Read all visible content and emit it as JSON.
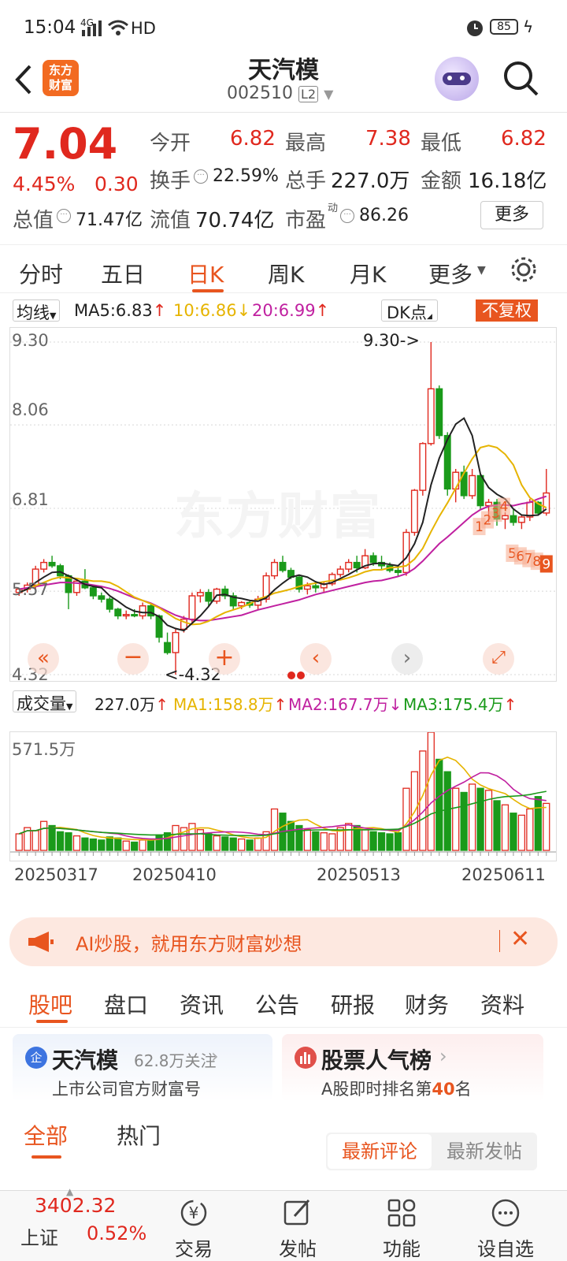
{
  "status_bar": {
    "time": "15:04",
    "net": "HD",
    "battery": "85"
  },
  "header": {
    "logo_text": "东方\n财富",
    "title": "天汽模",
    "code": "002510",
    "level": "L2"
  },
  "quote": {
    "price": "7.04",
    "change_pct": "4.45%",
    "change": "0.30",
    "open_label": "今开",
    "open": "6.82",
    "high_label": "最高",
    "high": "7.38",
    "low_label": "最低",
    "low": "6.82",
    "turnover_label": "换手",
    "turnover": "22.59%",
    "volume_label": "总手",
    "volume": "227.0万",
    "amount_label": "金额",
    "amount": "16.18亿",
    "mcap_label": "总值",
    "mcap": "71.47亿",
    "float_label": "流值",
    "float_cap": "70.74亿",
    "pe_label": "市盈",
    "pe_sup": "动",
    "pe": "86.26",
    "more": "更多"
  },
  "chart_tabs": [
    "分时",
    "五日",
    "日K",
    "周K",
    "月K",
    "更多"
  ],
  "ma_bar": {
    "selector": "均线",
    "ma5": "MA5:6.83",
    "ma10": "10:6.86",
    "ma20": "20:6.99",
    "dk": "DK点",
    "adjust": "不复权"
  },
  "price_axis": [
    "9.30",
    "8.06",
    "6.81",
    "5.57",
    "4.32"
  ],
  "annotations": {
    "high": "9.30->",
    "low": "<-4.32"
  },
  "watermark": "东方财富",
  "signals": [
    "1",
    "2",
    "3",
    "4",
    "5",
    "6",
    "7",
    "8",
    "9"
  ],
  "vol_bar": {
    "selector": "成交量",
    "vol": "227.0万",
    "ma1": "MA1:158.8万",
    "ma2": "MA2:167.7万",
    "ma3": "MA3:175.4万"
  },
  "vol_axis": "571.5万",
  "dates": [
    "20250317",
    "20250410",
    "20250513",
    "20250611"
  ],
  "banner": {
    "text": "AI炒股，就用东方财富妙想"
  },
  "info_tabs": [
    "股吧",
    "盘口",
    "资讯",
    "公告",
    "研报",
    "财务",
    "资料"
  ],
  "card1": {
    "badge": "企",
    "title": "天汽模",
    "follow": "62.8万关注",
    "sub": "上市公司官方财富号"
  },
  "card2": {
    "title": "股票人气榜",
    "sub_pre": "A股即时排名第",
    "rank": "40",
    "sub_post": "名"
  },
  "filter_tabs": [
    "全部",
    "热门"
  ],
  "sort_tabs": [
    "最新评论",
    "最新发帖"
  ],
  "bottom": {
    "index_value": "3402.32",
    "index_name": "上证",
    "index_pct": "0.52%",
    "items": [
      "交易",
      "发帖",
      "功能",
      "设自选"
    ]
  },
  "chart_data": {
    "type": "candlestick",
    "ylim": [
      4.32,
      9.3
    ],
    "candles": [
      [
        5.55,
        5.62,
        5.5,
        5.6
      ],
      [
        5.6,
        5.7,
        5.55,
        5.66
      ],
      [
        5.66,
        5.95,
        5.6,
        5.9
      ],
      [
        5.9,
        6.05,
        5.85,
        6.0
      ],
      [
        6.0,
        6.1,
        5.92,
        5.95
      ],
      [
        5.95,
        5.98,
        5.75,
        5.8
      ],
      [
        5.8,
        5.82,
        5.3,
        5.55
      ],
      [
        5.55,
        5.75,
        5.5,
        5.72
      ],
      [
        5.72,
        5.9,
        5.6,
        5.62
      ],
      [
        5.62,
        5.65,
        5.45,
        5.5
      ],
      [
        5.5,
        5.55,
        5.4,
        5.45
      ],
      [
        5.45,
        5.48,
        5.25,
        5.3
      ],
      [
        5.3,
        5.32,
        5.15,
        5.2
      ],
      [
        5.2,
        5.28,
        5.15,
        5.22
      ],
      [
        5.22,
        5.3,
        5.18,
        5.2
      ],
      [
        5.2,
        5.4,
        5.15,
        5.35
      ],
      [
        5.35,
        5.38,
        5.15,
        5.2
      ],
      [
        5.2,
        5.22,
        4.8,
        4.88
      ],
      [
        4.8,
        4.95,
        4.62,
        4.65
      ],
      [
        4.65,
        5.02,
        4.32,
        4.95
      ],
      [
        5.0,
        5.2,
        4.95,
        5.15
      ],
      [
        5.15,
        5.55,
        5.1,
        5.5
      ],
      [
        5.5,
        5.6,
        5.4,
        5.55
      ],
      [
        5.55,
        5.6,
        5.35,
        5.42
      ],
      [
        5.42,
        5.62,
        5.38,
        5.6
      ],
      [
        5.6,
        5.65,
        5.45,
        5.5
      ],
      [
        5.5,
        5.55,
        5.3,
        5.35
      ],
      [
        5.35,
        5.42,
        5.3,
        5.4
      ],
      [
        5.4,
        5.42,
        5.32,
        5.36
      ],
      [
        5.36,
        5.5,
        5.3,
        5.45
      ],
      [
        5.45,
        5.85,
        5.4,
        5.8
      ],
      [
        5.8,
        6.05,
        5.75,
        6.0
      ],
      [
        6.0,
        6.1,
        5.85,
        5.88
      ],
      [
        5.88,
        5.92,
        5.75,
        5.78
      ],
      [
        5.78,
        5.8,
        5.55,
        5.6
      ],
      [
        5.6,
        5.7,
        5.52,
        5.65
      ],
      [
        5.65,
        5.72,
        5.55,
        5.62
      ],
      [
        5.62,
        5.7,
        5.55,
        5.68
      ],
      [
        5.68,
        5.85,
        5.65,
        5.82
      ],
      [
        5.82,
        5.95,
        5.78,
        5.9
      ],
      [
        5.9,
        6.05,
        5.85,
        6.0
      ],
      [
        6.0,
        6.1,
        5.85,
        5.92
      ],
      [
        5.92,
        6.2,
        5.9,
        6.1
      ],
      [
        6.1,
        6.15,
        5.95,
        6.0
      ],
      [
        6.0,
        6.1,
        5.88,
        5.95
      ],
      [
        5.95,
        6.0,
        5.85,
        5.88
      ],
      [
        5.88,
        5.92,
        5.8,
        5.85
      ],
      [
        5.85,
        6.5,
        5.8,
        6.45
      ],
      [
        6.45,
        7.1,
        6.4,
        7.08
      ],
      [
        7.08,
        7.8,
        7.0,
        7.78
      ],
      [
        7.78,
        9.3,
        7.75,
        8.6
      ],
      [
        8.6,
        8.65,
        7.85,
        7.9
      ],
      [
        7.9,
        7.95,
        7.0,
        7.1
      ],
      [
        7.1,
        7.4,
        6.9,
        7.35
      ],
      [
        7.35,
        7.45,
        6.95,
        7.0
      ],
      [
        7.0,
        7.4,
        6.95,
        7.3
      ],
      [
        7.3,
        7.32,
        6.8,
        6.85
      ],
      [
        6.85,
        6.95,
        6.6,
        6.9
      ],
      [
        6.9,
        6.95,
        6.55,
        6.65
      ],
      [
        6.65,
        6.75,
        6.5,
        6.7
      ],
      [
        6.7,
        6.8,
        6.55,
        6.6
      ],
      [
        6.6,
        6.7,
        6.5,
        6.68
      ],
      [
        6.68,
        6.95,
        6.62,
        6.9
      ],
      [
        6.9,
        6.92,
        6.7,
        6.74
      ],
      [
        6.74,
        7.4,
        6.7,
        7.04
      ]
    ],
    "volume": [
      80,
      110,
      95,
      140,
      120,
      90,
      85,
      70,
      60,
      55,
      50,
      65,
      60,
      45,
      40,
      50,
      55,
      75,
      85,
      120,
      110,
      130,
      100,
      80,
      70,
      65,
      60,
      55,
      50,
      60,
      90,
      200,
      180,
      140,
      120,
      100,
      90,
      85,
      80,
      110,
      130,
      120,
      100,
      90,
      85,
      80,
      85,
      300,
      380,
      480,
      571,
      440,
      380,
      300,
      280,
      320,
      300,
      290,
      240,
      220,
      180,
      170,
      200,
      260,
      227
    ],
    "ma5": [
      5.55,
      5.6,
      5.7,
      5.78,
      5.85,
      5.86,
      5.8,
      5.74,
      5.67,
      5.64,
      5.62,
      5.5,
      5.42,
      5.33,
      5.27,
      5.25,
      5.25,
      5.19,
      5.06,
      5.01,
      4.98,
      5.09,
      5.2,
      5.34,
      5.51,
      5.52,
      5.48,
      5.46,
      5.43,
      5.42,
      5.47,
      5.59,
      5.69,
      5.78,
      5.81,
      5.78,
      5.71,
      5.67,
      5.7,
      5.76,
      5.82,
      5.89,
      5.95,
      5.98,
      5.99,
      5.97,
      5.95,
      6.07,
      6.28,
      6.6,
      7.16,
      7.56,
      7.84,
      8.07,
      8.16,
      7.9,
      7.32,
      7.12,
      7.02,
      6.95,
      6.8,
      6.71,
      6.7,
      6.71,
      6.8
    ],
    "ma10": [
      5.55,
      5.6,
      5.65,
      5.7,
      5.75,
      5.78,
      5.77,
      5.76,
      5.74,
      5.72,
      5.72,
      5.7,
      5.64,
      5.56,
      5.48,
      5.43,
      5.38,
      5.32,
      5.24,
      5.16,
      5.11,
      5.07,
      5.08,
      5.12,
      5.19,
      5.25,
      5.29,
      5.33,
      5.38,
      5.45,
      5.49,
      5.54,
      5.57,
      5.6,
      5.64,
      5.67,
      5.69,
      5.71,
      5.73,
      5.74,
      5.77,
      5.81,
      5.86,
      5.89,
      5.89,
      5.92,
      5.93,
      5.95,
      6.05,
      6.21,
      6.46,
      6.69,
      6.89,
      7.11,
      7.34,
      7.55,
      7.72,
      7.75,
      7.72,
      7.62,
      7.46,
      7.16,
      6.97,
      6.88,
      6.82
    ],
    "ma20": [
      5.6,
      5.62,
      5.64,
      5.66,
      5.68,
      5.7,
      5.7,
      5.69,
      5.68,
      5.66,
      5.64,
      5.61,
      5.57,
      5.52,
      5.47,
      5.43,
      5.39,
      5.33,
      5.27,
      5.21,
      5.17,
      5.14,
      5.13,
      5.13,
      5.15,
      5.17,
      5.19,
      5.21,
      5.25,
      5.29,
      5.32,
      5.35,
      5.38,
      5.41,
      5.44,
      5.48,
      5.52,
      5.55,
      5.58,
      5.61,
      5.64,
      5.67,
      5.7,
      5.72,
      5.73,
      5.76,
      5.79,
      5.83,
      5.91,
      6.02,
      6.15,
      6.28,
      6.38,
      6.49,
      6.6,
      6.71,
      6.79,
      6.84,
      6.86,
      6.86,
      6.85,
      6.88,
      6.9,
      6.95,
      6.99
    ]
  }
}
